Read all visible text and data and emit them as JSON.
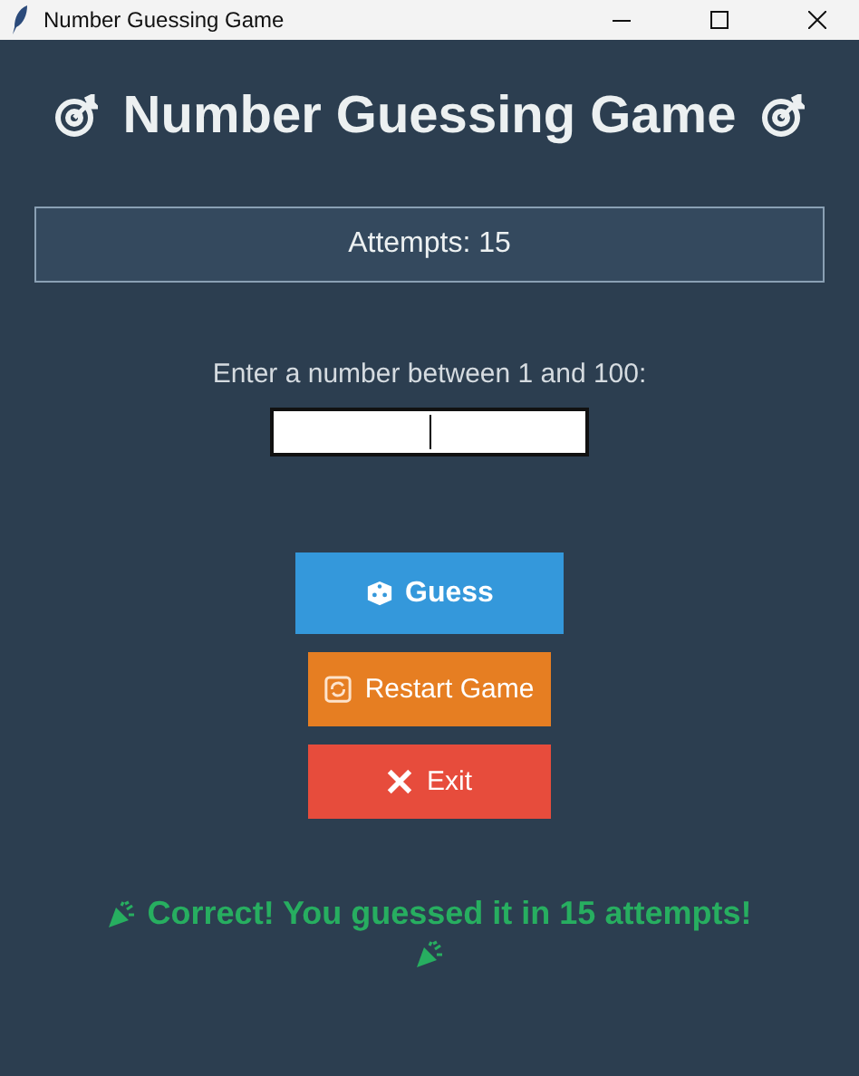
{
  "window": {
    "title": "Number Guessing Game"
  },
  "heading": "Number Guessing Game",
  "attempts_panel": "Attempts: 15",
  "prompt": "Enter a number between 1 and 100:",
  "buttons": [
    {
      "kind": "guess",
      "label": "Guess"
    },
    {
      "kind": "restart",
      "label": "Restart Game"
    },
    {
      "kind": "exit",
      "label": "Exit"
    }
  ],
  "message": "Correct! You guessed it in 15 attempts!"
}
